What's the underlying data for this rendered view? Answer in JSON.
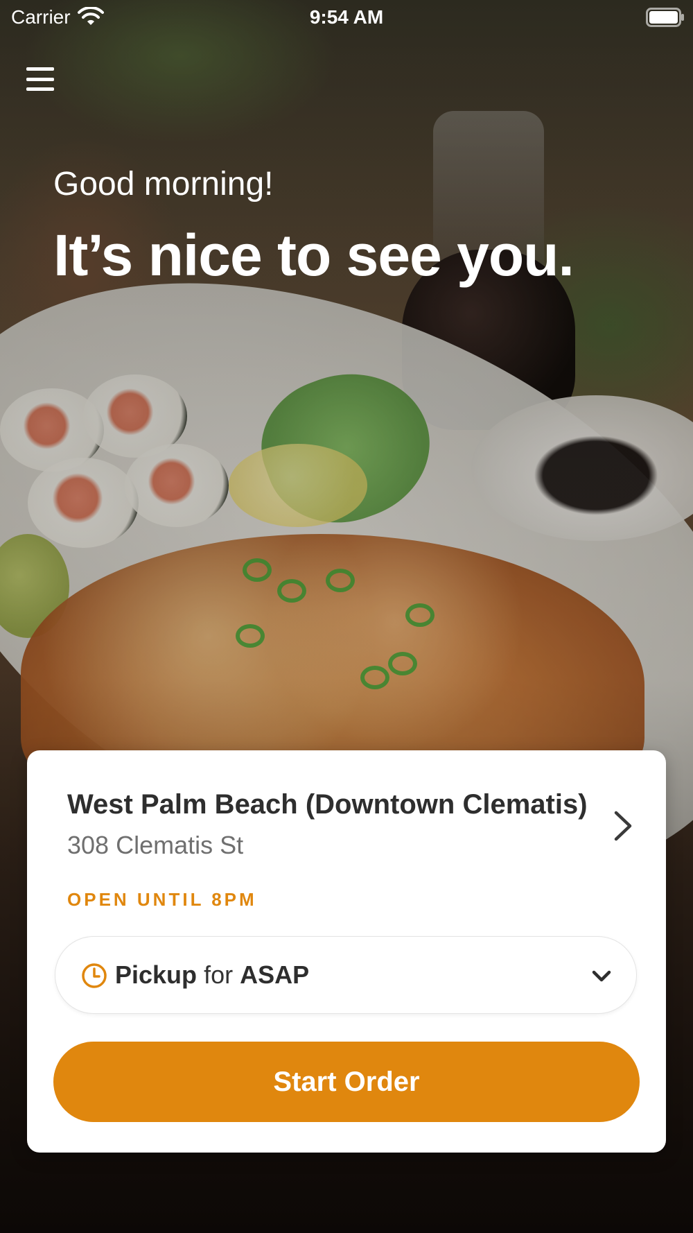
{
  "status_bar": {
    "carrier": "Carrier",
    "time": "9:54 AM"
  },
  "icons": {
    "menu": "hamburger-menu-icon",
    "wifi": "wifi-icon",
    "battery": "battery-icon",
    "chevron_right": "chevron-right-icon",
    "clock": "clock-icon",
    "chevron_down": "chevron-down-icon"
  },
  "greeting": {
    "subtitle": "Good morning!",
    "headline": "It’s nice to see you."
  },
  "location": {
    "name": "West Palm Beach (Downtown Clematis)",
    "address": "308 Clematis St",
    "hours_status": "OPEN UNTIL 8PM"
  },
  "order_mode": {
    "mode": "Pickup",
    "connector": "for",
    "time": "ASAP"
  },
  "actions": {
    "start_order": "Start Order"
  },
  "colors": {
    "accent": "#E0870E",
    "text_dark": "#2E2E2E",
    "text_muted": "#6F6F6F",
    "card_bg": "#FFFFFF"
  }
}
